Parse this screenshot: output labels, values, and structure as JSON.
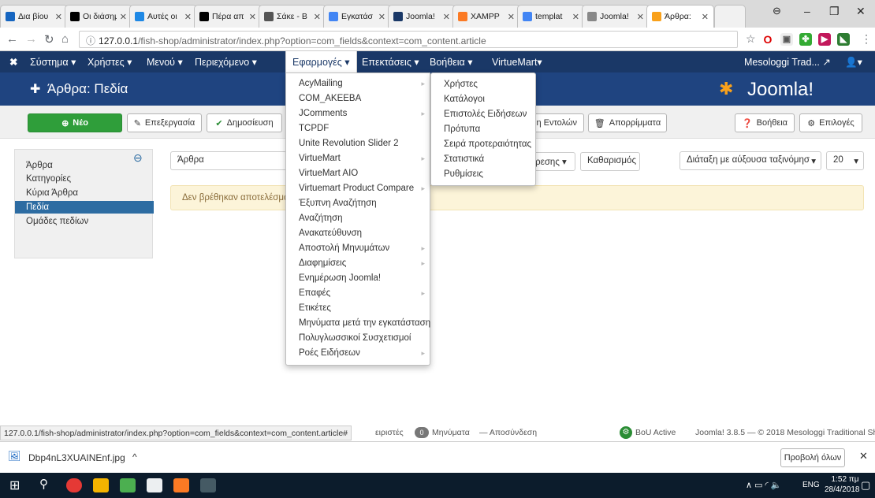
{
  "browser": {
    "tabs": [
      {
        "label": "Δια βίου",
        "icon_color": "#1565c0"
      },
      {
        "label": "Οι διάσημ",
        "icon_color": "#000000"
      },
      {
        "label": "Αυτές οι",
        "icon_color": "#1e88e5"
      },
      {
        "label": "Πέρα απ",
        "icon_color": "#000000"
      },
      {
        "label": "Σάκε - Β",
        "icon_color": "#555555"
      },
      {
        "label": "Εγκατάσ",
        "icon_color": "#4285f4"
      },
      {
        "label": "Joomla!",
        "icon_color": "#1a3867"
      },
      {
        "label": "XAMPP",
        "icon_color": "#fb7a24"
      },
      {
        "label": "templat",
        "icon_color": "#4285f4"
      },
      {
        "label": "Joomla!",
        "icon_color": "#888888"
      },
      {
        "label": "Άρθρα:",
        "icon_color": "#f9a11b"
      }
    ],
    "url_host": "127.0.0.1",
    "url_path": "/fish-shop/administrator/index.php?option=com_fields&context=com_content.article",
    "window_controls": {
      "minimize": "–",
      "maximize": "❐",
      "close": "✕"
    }
  },
  "joomla_nav": {
    "items": [
      "Σύστημα ▾",
      "Χρήστες ▾",
      "Μενού ▾",
      "Περιεχόμενο ▾",
      "Εφαρμογές ▾",
      "Επεκτάσεις ▾",
      "Βοήθεια ▾",
      "VirtueMart▾"
    ],
    "site_name": "Mesologgi Trad...",
    "user_icon": "user-icon"
  },
  "page": {
    "title": "Άρθρα: Πεδία",
    "brand": "Joomla!"
  },
  "toolbar": {
    "new": "Νέο",
    "edit": "Επεξεργασία",
    "publish": "Δημοσίευση",
    "batch": "μη Εντολών",
    "trash": "Απορρίμματα",
    "help": "Βοήθεια",
    "options": "Επιλογές"
  },
  "sidebar": {
    "items": [
      "Άρθρα",
      "Κατηγορίες",
      "Κύρια Άρθρα",
      "Πεδία",
      "Ομάδες πεδίων"
    ],
    "active_index": 3
  },
  "filters": {
    "context_select": "Άρθρα",
    "options_btn": "ρεσης ▾",
    "clear": "Καθαρισμός",
    "ordering": "Διάταξη με αύξουσα ταξινόμησ",
    "limit": "20"
  },
  "alert": "Δεν βρέθηκαν αποτελέσματα",
  "components_menu": {
    "items": [
      {
        "label": "AcyMailing",
        "submenu": true
      },
      {
        "label": "COM_AKEEBA",
        "submenu": false
      },
      {
        "label": "JComments",
        "submenu": true
      },
      {
        "label": "TCPDF",
        "submenu": false
      },
      {
        "label": "Unite Revolution Slider 2",
        "submenu": false
      },
      {
        "label": "VirtueMart",
        "submenu": true
      },
      {
        "label": "VirtueMart AIO",
        "submenu": false
      },
      {
        "label": "Virtuemart Product Compare",
        "submenu": true
      },
      {
        "label": "Έξυπνη Αναζήτηση",
        "submenu": false
      },
      {
        "label": "Αναζήτηση",
        "submenu": false
      },
      {
        "label": "Ανακατεύθυνση",
        "submenu": false
      },
      {
        "label": "Αποστολή Μηνυμάτων",
        "submenu": true
      },
      {
        "label": "Διαφημίσεις",
        "submenu": true
      },
      {
        "label": "Ενημέρωση Joomla!",
        "submenu": false
      },
      {
        "label": "Επαφές",
        "submenu": true
      },
      {
        "label": "Ετικέτες",
        "submenu": false
      },
      {
        "label": "Μηνύματα μετά την εγκατάσταση",
        "submenu": false
      },
      {
        "label": "Πολυγλωσσικοί Συσχετισμοί",
        "submenu": false
      },
      {
        "label": "Ροές Ειδήσεων",
        "submenu": true
      }
    ]
  },
  "submenu": {
    "items": [
      "Χρήστες",
      "Κατάλογοι",
      "Επιστολές Ειδήσεων",
      "Πρότυπα",
      "Σειρά προτεραιότητας",
      "Στατιστικά",
      "Ρυθμίσεις"
    ]
  },
  "status": {
    "hover_url": "127.0.0.1/fish-shop/administrator/index.php?option=com_fields&context=com_content.article#",
    "partial": "ειριστές",
    "messages_count": "0",
    "messages": "Μηνύματα",
    "logout": "— Αποσύνδεση",
    "bou": "BoU Active",
    "version": "Joomla! 3.8.5 — © 2018 Mesologgi Traditional Shop"
  },
  "download": {
    "file": "Dbp4nL3XUAINEnf.jpg",
    "show_all": "Προβολή όλων"
  },
  "taskbar": {
    "lang": "ENG",
    "time": "1:52 πμ",
    "date": "28/4/2018"
  }
}
